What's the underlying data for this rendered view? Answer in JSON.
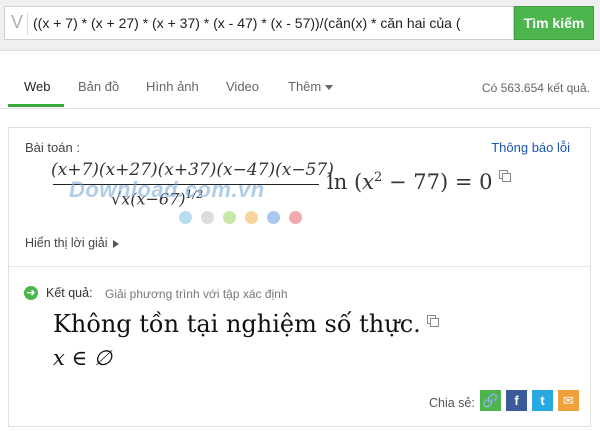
{
  "search": {
    "query": "((x + 7) * (x + 27) * (x + 37) * (x - 47) * (x - 57))/(căn(x) * căn hai của (",
    "button_label": "Tìm kiếm",
    "logo": "V"
  },
  "tabs": [
    {
      "label": "Web",
      "active": true
    },
    {
      "label": "Bản đồ"
    },
    {
      "label": "Hình ảnh"
    },
    {
      "label": "Video"
    },
    {
      "label": "Thêm"
    }
  ],
  "result_count": "Có 563.654 kết quả.",
  "card": {
    "problem_label": "Bài toán :",
    "report_link": "Thông báo lỗi",
    "formula": {
      "numerator": "(x+7)(x+27)(x+37)(x−47)(x−57)",
      "denominator_main": "√x(x−67)",
      "denominator_exp": "1/2",
      "rhs_ln": "ln",
      "rhs_open": "(",
      "rhs_x": "x",
      "rhs_exp": "2",
      "rhs_rest": "− 77",
      "rhs_close": ")",
      "rhs_eq": "= 0"
    },
    "watermark": "Download.com.vn",
    "watermark_dot_colors": [
      "#b8dcef",
      "#dcdcdc",
      "#c7e8a8",
      "#f7d59a",
      "#a9c9ee",
      "#f3a9b0"
    ],
    "show_steps": "Hiển thị lời giải",
    "result_label": "Kết quả:",
    "result_desc": "Giải phương trình với tập xác định",
    "answer_text": "Không tồn tại nghiệm số thực.",
    "answer_math": "x ∈ ∅",
    "share_label": "Chia sẻ:",
    "share_buttons": [
      {
        "name": "link-icon",
        "color": "#4cb54c",
        "glyph": "🔗"
      },
      {
        "name": "facebook-icon",
        "color": "#3b5b9b",
        "glyph": "f"
      },
      {
        "name": "twitter-icon",
        "color": "#29a9e1",
        "glyph": "t"
      },
      {
        "name": "email-icon",
        "color": "#f0a23a",
        "glyph": "✉"
      }
    ]
  },
  "colors": {
    "accent_green": "#4cb54c",
    "link_blue": "#1a55b5",
    "tab_underline": "#39a83a"
  }
}
